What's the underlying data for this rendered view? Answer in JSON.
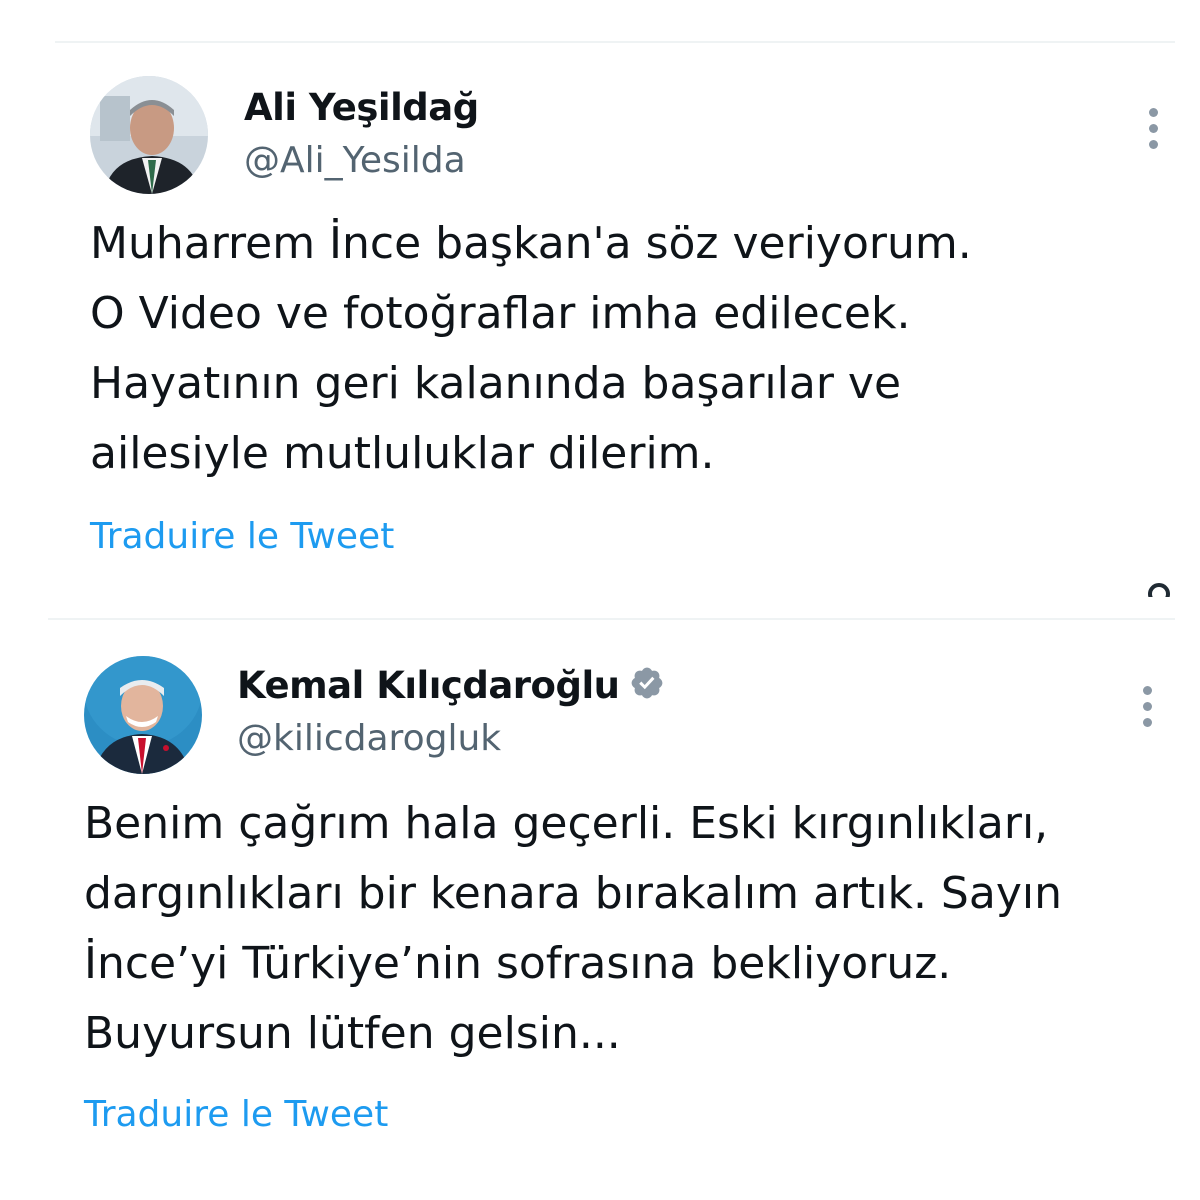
{
  "tweets": [
    {
      "author_name": "Ali Yeşildağ",
      "handle": "@Ali_Yesilda",
      "verified": false,
      "text_lines": [
        "Muharrem İnce başkan'a söz veriyorum.",
        "O Video ve fotoğraflar imha edilecek.",
        "Hayatının geri kalanında başarılar ve",
        "ailesiyle mutluluklar dilerim."
      ],
      "translate_label": "Traduire le Tweet",
      "more_icon": "more-vertical-icon"
    },
    {
      "author_name": "Kemal Kılıçdaroğlu",
      "handle": "@kilicdarogluk",
      "verified": true,
      "verified_icon": "verified-badge-icon",
      "text_lines": [
        "Benim çağrım hala geçerli. Eski kırgınlıkları,",
        "dargınlıkları bir kenara bırakalım artık. Sayın",
        "İnce’yi Türkiye’nin sofrasına bekliyoruz.",
        "Buyursun lütfen gelsin..."
      ],
      "translate_label": "Traduire le Tweet",
      "more_icon": "more-vertical-icon"
    }
  ],
  "colors": {
    "text": "#0f1419",
    "secondary": "#536471",
    "link": "#1d9bf0",
    "divider": "#eff3f4",
    "verified_badge": "#8b98a5"
  }
}
